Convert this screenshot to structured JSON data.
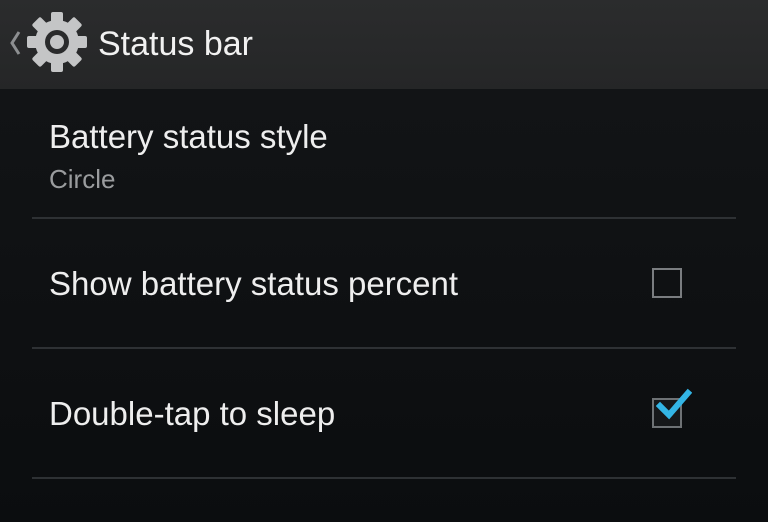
{
  "action_bar": {
    "title": "Status bar",
    "icon": "gear-icon",
    "back_icon": "chevron-left-icon"
  },
  "preferences": [
    {
      "title": "Battery status style",
      "summary": "Circle"
    },
    {
      "title": "Show battery status percent",
      "checked": false
    },
    {
      "title": "Double-tap to sleep",
      "checked": true
    }
  ],
  "colors": {
    "accent": "#33b5e5",
    "action_bar_bg": "#282929",
    "background": "#101214",
    "divider": "#2e3134"
  }
}
